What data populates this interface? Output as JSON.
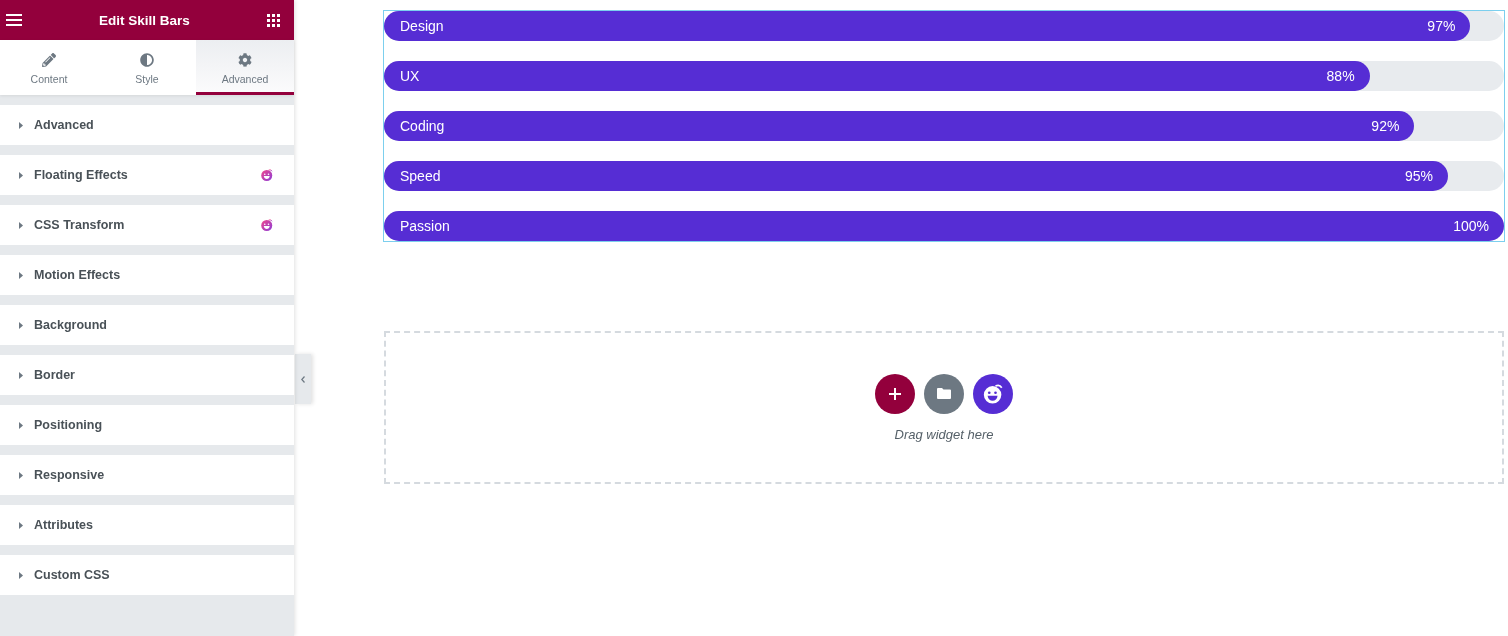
{
  "panel": {
    "title": "Edit Skill Bars",
    "tabs": [
      {
        "label": "Content",
        "selected": false
      },
      {
        "label": "Style",
        "selected": false
      },
      {
        "label": "Advanced",
        "selected": true
      }
    ],
    "sections": [
      {
        "label": "Advanced",
        "expanded": false,
        "addon": false
      },
      {
        "label": "Floating Effects",
        "expanded": false,
        "addon": true
      },
      {
        "label": "CSS Transform",
        "expanded": false,
        "addon": true
      },
      {
        "label": "Motion Effects",
        "expanded": false,
        "addon": false
      },
      {
        "label": "Background",
        "expanded": false,
        "addon": false
      },
      {
        "label": "Border",
        "expanded": false,
        "addon": false
      },
      {
        "label": "Positioning",
        "expanded": false,
        "addon": false
      },
      {
        "label": "Responsive",
        "expanded": false,
        "addon": false
      },
      {
        "label": "Attributes",
        "expanded": false,
        "addon": false
      },
      {
        "label": "Custom CSS",
        "expanded": false,
        "addon": false
      }
    ]
  },
  "skills": [
    {
      "label": "Design",
      "reading": "97%",
      "level": 0.97
    },
    {
      "label": "UX",
      "reading": "88%",
      "level": 0.88
    },
    {
      "label": "Coding",
      "reading": "92%",
      "level": 0.92
    },
    {
      "label": "Speed",
      "reading": "95%",
      "level": 0.95
    },
    {
      "label": "Passion",
      "reading": "100%",
      "level": 1
    }
  ],
  "drop_zone": {
    "hint": "Drag widget here"
  }
}
